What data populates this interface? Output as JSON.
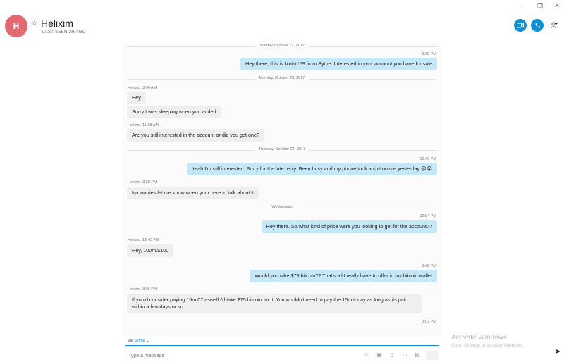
{
  "window": {
    "minimize": "–",
    "maximize": "❐",
    "close": "✕"
  },
  "header": {
    "avatar_initial": "H",
    "name": "Helixim",
    "last_seen": "LAST SEEN 2H AGO",
    "buttons": {
      "video_icon": "video-camera-icon",
      "call_icon": "phone-icon",
      "add_icon": "add-person-icon"
    }
  },
  "messages": {
    "sep1": "Sunday, October 22, 2017",
    "t1": "9:10 PM",
    "m1": "Hey there, this is Moist159 from Sythe. Interested in your account you have for sale",
    "sep2": "Monday, October 23, 2017",
    "s1": "Helixim, 3:06 AM",
    "m2": "Hey",
    "m3": "Sorry I was sleeping when you added",
    "s2": "Helixim, 11:38 AM",
    "m4": "Are you still interested in the account or did you get one?",
    "sep3": "Tuesday, October 24, 2017",
    "t2": "12:45 PM",
    "m5": "Yeah I'm still interested. Sorry for the late reply. Been busy and my phone took a shit on me yesterday 😫😭",
    "s3": "Helixim, 3:28 PM",
    "m6": "No worries let me know when your here to talk about it",
    "sep4": "Wednesday",
    "t3": "12:04 PM",
    "m7": "Hey there. So what kind of price were you looking to get for the account??",
    "s4": "Helixim, 12:45 PM",
    "m8": "Hey, 100m/$100",
    "t4": "3:05 PM",
    "m9": "Would you take $75 bitcoin?? That's all I really have to offer in my bitcoin wallet",
    "s5": "Helixim, 3:06 PM",
    "m10": "If you'd consider paying 15m 07 aswell i'd take $75 bitcoin for it, You wouldn't need to pay the 15m today as long as its paid within a few days or so",
    "t5": "3:07 PM"
  },
  "compose": {
    "via_prefix": "Via",
    "via_service": "Skype",
    "placeholder": "Type a message"
  },
  "watermark": {
    "line1": "Activate Windows",
    "line2": "Go to Settings to activate Windows."
  }
}
